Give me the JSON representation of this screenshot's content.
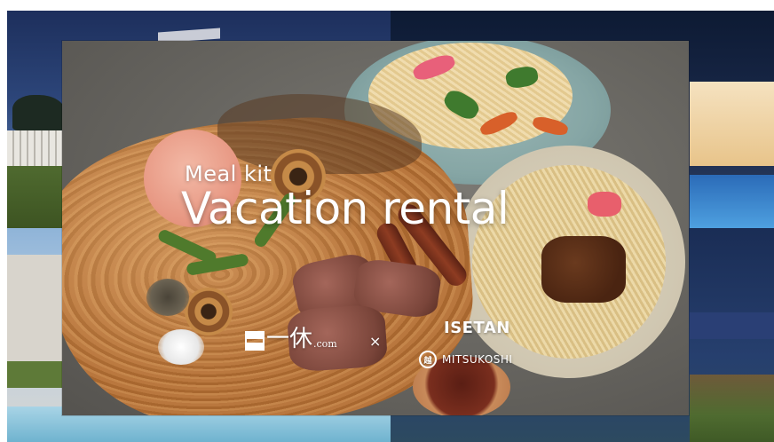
{
  "banner": {
    "eyebrow": "Meal kit",
    "headline": "Vacation rental"
  },
  "logos": {
    "ikyu_mark": "一休",
    "ikyu_suffix": ".com",
    "separator": "×",
    "isetan": "ISETAN",
    "mitsukoshi": "MITSUKOSHI"
  },
  "colors": {
    "headline": "#ffffff",
    "background_night_sky": "#1d2f5c",
    "board_wood": "#b9773e"
  }
}
